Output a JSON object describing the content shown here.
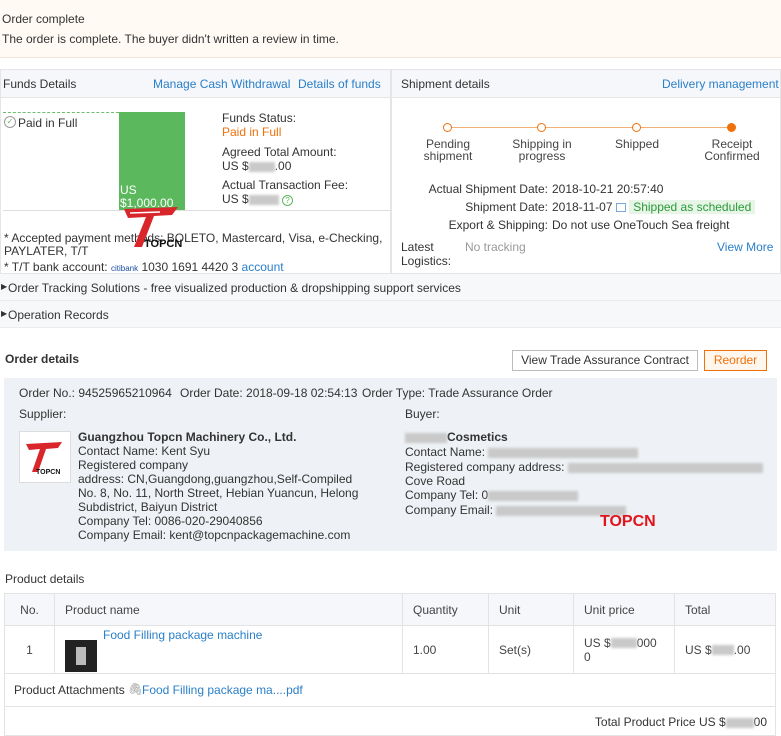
{
  "banner": {
    "title": "Order complete",
    "message": "The order is complete. The buyer didn't written a review in time."
  },
  "funds": {
    "header": "Funds Details",
    "manage_link": "Manage Cash Withdrawal",
    "details_link": "Details of funds",
    "paid_full_label": "Paid in Full",
    "bar_label": "US $1,000.00",
    "status_label": "Funds Status:",
    "status_value": "Paid in Full",
    "agreed_label": "Agreed Total Amount:",
    "agreed_value_prefix": "US $",
    "agreed_value_suffix": ".00",
    "fee_label": "Actual Transaction Fee:",
    "fee_value_prefix": "US $",
    "payment_methods": "* Accepted payment methods: BOLETO, Mastercard, Visa, e-Checking, PAYLATER, T/T",
    "bank_label": "* T/T bank account:",
    "bank_name": "citibank",
    "bank_number": "1030 1691 4420 3",
    "bank_account_link": "account"
  },
  "shipment": {
    "header": "Shipment details",
    "delivery_link": "Delivery management",
    "steps": [
      "Pending shipment",
      "Shipping in progress",
      "Shipped",
      "Receipt Confirmed"
    ],
    "actual_date_label": "Actual Shipment Date:",
    "actual_date_value": "2018-10-21 20:57:40",
    "ship_date_label": "Shipment Date:",
    "ship_date_value": "2018-11-07",
    "ship_status": "Shipped as scheduled",
    "export_label": "Export & Shipping:",
    "export_value": "Do not use OneTouch Sea freight",
    "logistics_label": "Latest Logistics:",
    "logistics_value": "No tracking",
    "view_more": "View More"
  },
  "bars": {
    "tracking": "Order Tracking Solutions - free visualized production & dropshipping support services",
    "operation": "Operation Records"
  },
  "order": {
    "header": "Order details",
    "contract_button": "View Trade Assurance Contract",
    "reorder_button": "Reorder",
    "order_no": "Order No.: 94525965210964",
    "order_date": "Order Date: 2018-09-18 02:54:13",
    "order_type": "Order Type: Trade Assurance Order",
    "supplier_label": "Supplier:",
    "buyer_label": "Buyer:",
    "supplier": {
      "name": "Guangzhou Topcn Machinery Co., Ltd.",
      "contact": "Contact Name: Kent Syu",
      "registered": "Registered company",
      "address": "address: CN,Guangdong,guangzhou,Self-Compiled No. 8, No. 11, North Street, Hebian Yuancun, Helong Subdistrict, Baiyun District",
      "tel": "Company Tel: 0086-020-29040856",
      "email": "Company Email: kent@topcnpackagemachine.com"
    },
    "buyer": {
      "name_suffix": "Cosmetics",
      "contact": "Contact Name:",
      "registered": "Registered company address:",
      "road": "Cove Road",
      "tel": "Company Tel: 0",
      "email": "Company Email:"
    },
    "stamp": "TOPCN"
  },
  "product": {
    "header": "Product details",
    "columns": [
      "No.",
      "Product name",
      "Quantity",
      "Unit",
      "Unit price",
      "Total"
    ],
    "row": {
      "no": "1",
      "name": "Food Filling package machine",
      "quantity": "1.00",
      "unit": "Set(s)",
      "unit_price_prefix": "US $",
      "unit_price_suffix": "000",
      "unit_price_tail": "0",
      "total_prefix": "US $",
      "total_suffix": ".00"
    },
    "attachments_label": "Product Attachments",
    "attachment_file": "Food Filling package ma....pdf",
    "total_label": "Total Product Price",
    "total_prefix": "US $",
    "total_suffix": "00"
  },
  "logo_text": "TOPCN"
}
